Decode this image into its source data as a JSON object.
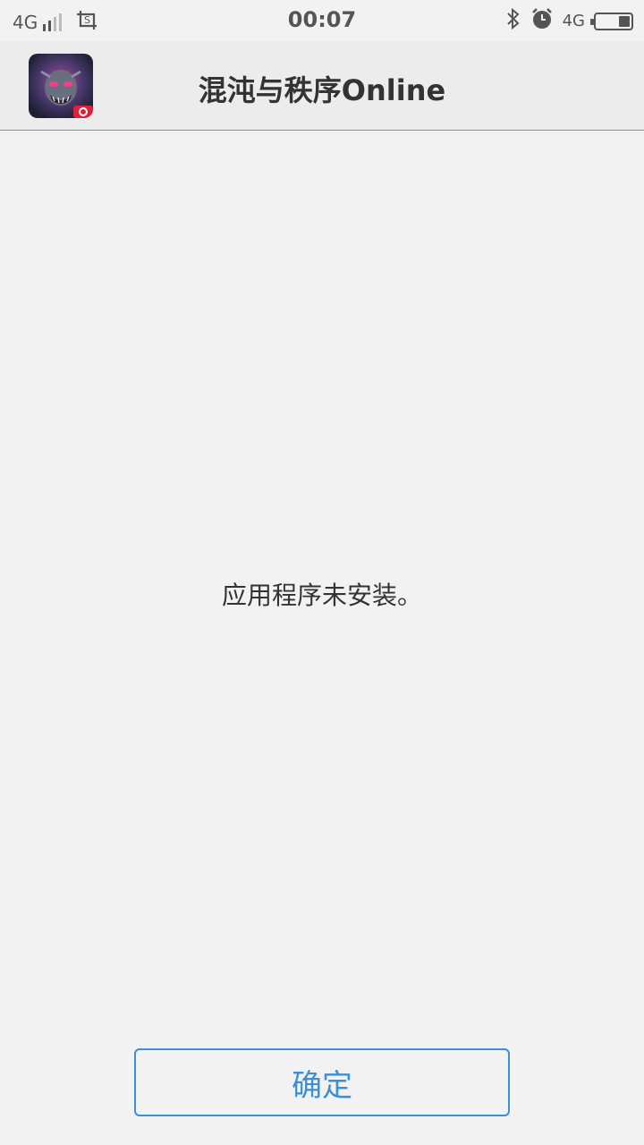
{
  "status_bar": {
    "network_left": "4G",
    "time": "00:07",
    "network_right": "4G",
    "icons": [
      "signal-icon",
      "screenshot-icon",
      "bluetooth-icon",
      "alarm-icon",
      "battery-icon"
    ]
  },
  "header": {
    "app_icon": "game-app-icon",
    "title": "混沌与秩序Online"
  },
  "main": {
    "message": "应用程序未安装。"
  },
  "footer": {
    "confirm_label": "确定"
  },
  "colors": {
    "accent": "#3a8fd8",
    "background": "#f2f2f2",
    "header_background": "#ececec",
    "text": "#333333"
  }
}
